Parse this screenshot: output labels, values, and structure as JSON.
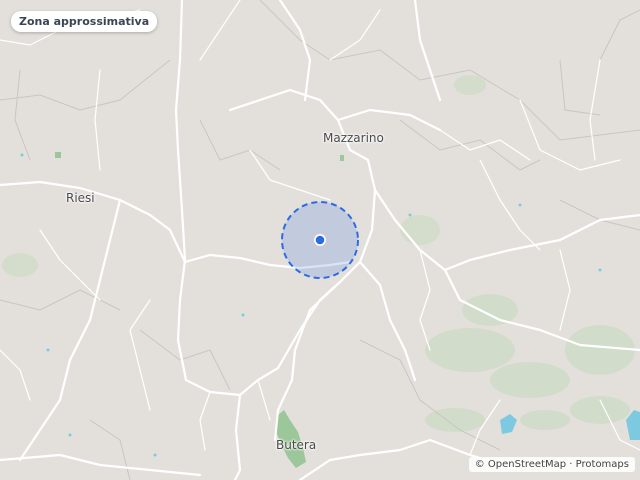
{
  "badge": {
    "label": "Zona approssimativa"
  },
  "places": {
    "mazzarino": "Mazzarino",
    "riesi": "Riesi",
    "butera": "Butera"
  },
  "attribution": {
    "symbol": "©",
    "osm": "OpenStreetMap",
    "separator": "·",
    "protomaps": "Protomaps"
  },
  "colors": {
    "land": "#e3e0dc",
    "road": "#ffffff",
    "boundary": "#c9c5c0",
    "water": "#7dc9df",
    "park": "#c8dcc4",
    "accent": "#2d6be4"
  }
}
